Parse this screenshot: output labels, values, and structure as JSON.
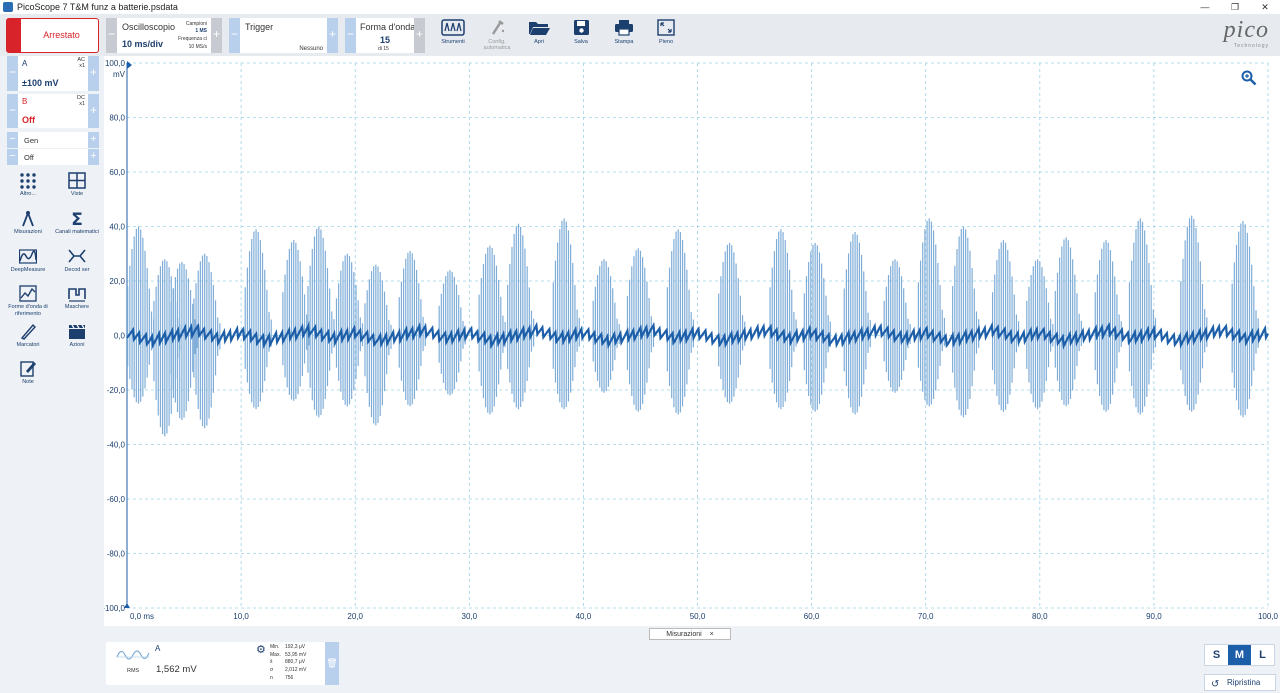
{
  "window": {
    "title": "PicoScope 7 T&M funz a batterie.psdata",
    "controls": [
      "—",
      "❐",
      "✕"
    ]
  },
  "toolbar": {
    "run_state": "Arrestato",
    "scope": {
      "label": "Oscilloscopio",
      "timebase": "10 ms/div",
      "samples_label": "Campioni",
      "samples": "1 MS",
      "freq_label": "Frequenza ci",
      "freq": "10 MS/s"
    },
    "trigger": {
      "label": "Trigger",
      "mode": "Nessuno"
    },
    "waveform": {
      "label": "Forma d'onda",
      "current": "15",
      "of": "di 15"
    },
    "tools": [
      {
        "label": "Strumenti",
        "icon": "instruments-icon"
      },
      {
        "label": "Config. automatica",
        "icon": "auto-setup-icon"
      },
      {
        "label": "Apri",
        "icon": "open-folder-icon"
      },
      {
        "label": "Salva",
        "icon": "save-icon"
      },
      {
        "label": "Stampa",
        "icon": "print-icon"
      },
      {
        "label": "Pieno",
        "icon": "fullscreen-icon"
      }
    ],
    "logo": "pico",
    "logo_sub": "Technology"
  },
  "channels": [
    {
      "name": "A",
      "coupling": "AC",
      "probe": "x1",
      "range": "±100 mV",
      "color": "#1d5ea8"
    },
    {
      "name": "B",
      "coupling": "DC",
      "probe": "x1",
      "range": "Off",
      "color": "#d8232a"
    }
  ],
  "generator": {
    "name": "Gen",
    "state": "Off"
  },
  "sidebar_items": [
    {
      "label": "Altro...",
      "icon": "more-icon"
    },
    {
      "label": "Viste",
      "icon": "views-icon"
    },
    {
      "label": "Misurazioni",
      "icon": "measurements-icon"
    },
    {
      "label": "Canali matematici",
      "icon": "math-channels-icon"
    },
    {
      "label": "DeepMeasure",
      "icon": "deepmeasure-icon"
    },
    {
      "label": "Decod ser",
      "icon": "serial-decode-icon"
    },
    {
      "label": "Forme d'onda di riferimento",
      "icon": "reference-waveform-icon"
    },
    {
      "label": "Maschere",
      "icon": "masks-icon"
    },
    {
      "label": "Marcatori",
      "icon": "rulers-icon"
    },
    {
      "label": "Azioni",
      "icon": "actions-icon"
    },
    {
      "label": "Note",
      "icon": "notes-icon"
    }
  ],
  "plot": {
    "y_unit": "mV",
    "y_ticks": [
      "100,0",
      "80,0",
      "60,0",
      "40,0",
      "20,0",
      "0,0",
      "-20,0",
      "-40,0",
      "-60,0",
      "-80,0",
      "-100,0"
    ],
    "x_ticks": [
      "0,0 ms",
      "10,0",
      "20,0",
      "30,0",
      "40,0",
      "50,0",
      "60,0",
      "70,0",
      "80,0",
      "90,0",
      "100,0"
    ],
    "grid_color": "#9fd3e6",
    "trace_color": "#1d5ea8",
    "burst_color": "#7fadd8"
  },
  "chart_data": {
    "type": "line",
    "title": "",
    "xlabel": "ms",
    "ylabel": "mV",
    "xlim": [
      0,
      100
    ],
    "ylim": [
      -100,
      100
    ],
    "grid": true,
    "series": [
      {
        "name": "A",
        "x": [
          0,
          2,
          4,
          6,
          8,
          10,
          12,
          14,
          16,
          18,
          20,
          22,
          24,
          26,
          28,
          30,
          32,
          34,
          36,
          38,
          40,
          42,
          44,
          46,
          48,
          50,
          52,
          54,
          56,
          58,
          60,
          62,
          64,
          66,
          68,
          70,
          72,
          74,
          76,
          78,
          80,
          82,
          84,
          86,
          88,
          90,
          92,
          94,
          96,
          98,
          100
        ],
        "values": [
          1,
          -2,
          0,
          2,
          -1,
          1,
          -2,
          0,
          2,
          -1,
          1,
          -2,
          0,
          2,
          -1,
          1,
          -2,
          0,
          2,
          -1,
          1,
          -2,
          0,
          2,
          -1,
          1,
          -2,
          0,
          2,
          -1,
          1,
          -2,
          0,
          2,
          -1,
          1,
          -2,
          0,
          2,
          -1,
          1,
          -2,
          0,
          2,
          -1,
          1,
          -2,
          0,
          2,
          -1,
          1
        ]
      }
    ],
    "bursts": [
      {
        "x": 1.2,
        "max": 40,
        "min": -25
      },
      {
        "x": 3.5,
        "max": 28,
        "min": -37
      },
      {
        "x": 5.0,
        "max": 27,
        "min": -31
      },
      {
        "x": 7.0,
        "max": 30,
        "min": -34
      },
      {
        "x": 11.5,
        "max": 39,
        "min": -27
      },
      {
        "x": 14.8,
        "max": 35,
        "min": -24
      },
      {
        "x": 17.0,
        "max": 40,
        "min": -30
      },
      {
        "x": 19.5,
        "max": 30,
        "min": -26
      },
      {
        "x": 22.0,
        "max": 26,
        "min": -33
      },
      {
        "x": 25.0,
        "max": 31,
        "min": -26
      },
      {
        "x": 28.5,
        "max": 24,
        "min": -22
      },
      {
        "x": 32.0,
        "max": 33,
        "min": -29
      },
      {
        "x": 34.5,
        "max": 41,
        "min": -27
      },
      {
        "x": 38.5,
        "max": 43,
        "min": -27
      },
      {
        "x": 42.0,
        "max": 28,
        "min": -21
      },
      {
        "x": 45.0,
        "max": 32,
        "min": -28
      },
      {
        "x": 48.5,
        "max": 39,
        "min": -29
      },
      {
        "x": 53.0,
        "max": 34,
        "min": -25
      },
      {
        "x": 57.5,
        "max": 39,
        "min": -27
      },
      {
        "x": 60.5,
        "max": 34,
        "min": -28
      },
      {
        "x": 64.0,
        "max": 38,
        "min": -29
      },
      {
        "x": 67.5,
        "max": 28,
        "min": -21
      },
      {
        "x": 70.5,
        "max": 43,
        "min": -26
      },
      {
        "x": 73.5,
        "max": 40,
        "min": -30
      },
      {
        "x": 77.0,
        "max": 35,
        "min": -28
      },
      {
        "x": 80.0,
        "max": 28,
        "min": -27
      },
      {
        "x": 82.5,
        "max": 36,
        "min": -26
      },
      {
        "x": 86.0,
        "max": 35,
        "min": -28
      },
      {
        "x": 89.0,
        "max": 43,
        "min": -29
      },
      {
        "x": 93.5,
        "max": 44,
        "min": -28
      },
      {
        "x": 98.0,
        "max": 42,
        "min": -30
      }
    ]
  },
  "measurements": {
    "tab_label": "Misurazioni",
    "tab_close": "×",
    "channel": "A",
    "type": "RMS",
    "value": "1,562 mV",
    "stats": [
      {
        "k": "Min.",
        "v": "192,3 μV"
      },
      {
        "k": "Max.",
        "v": "53,95 mV"
      },
      {
        "k": "x̄",
        "v": "880,7 μV"
      },
      {
        "k": "σ",
        "v": "2,012 mV"
      },
      {
        "k": "n",
        "v": "756"
      }
    ]
  },
  "view_size": {
    "options": [
      "S",
      "M",
      "L"
    ],
    "selected": "M"
  },
  "reset_label": "Ripristina"
}
